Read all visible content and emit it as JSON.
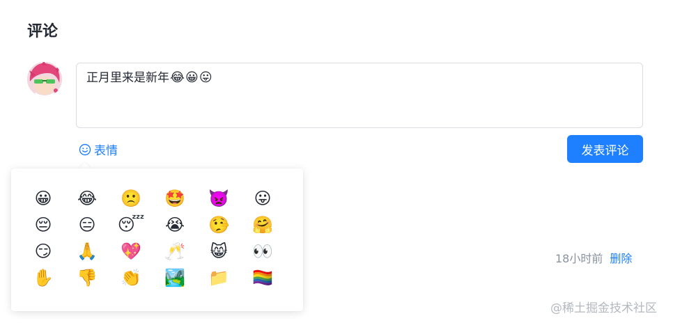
{
  "comments": {
    "title": "评论",
    "editor": {
      "text": "正月里来是新年",
      "emojis": [
        "😂",
        "😀",
        "😛"
      ]
    },
    "emoji_button_label": "表情",
    "submit_label": "发表评论",
    "emoji_panel": {
      "emojis": [
        "😀",
        "😂",
        "🙁",
        "🤩",
        "👿",
        "😛",
        "😔",
        "😑",
        "😴",
        "😭",
        "🤥",
        "🤗",
        "😏",
        "🙏",
        "💖",
        "🥂",
        "😸",
        "👀",
        "✋",
        "👎",
        "👏",
        "🏞️",
        "📁",
        "🏳️‍🌈"
      ]
    },
    "meta": {
      "time": "18小时前",
      "delete_label": "删除"
    }
  },
  "watermark": "@稀土掘金技术社区",
  "colors": {
    "accent": "#1e80ff",
    "text": "#252933",
    "muted": "#8a919f",
    "border": "#d9dce1"
  }
}
